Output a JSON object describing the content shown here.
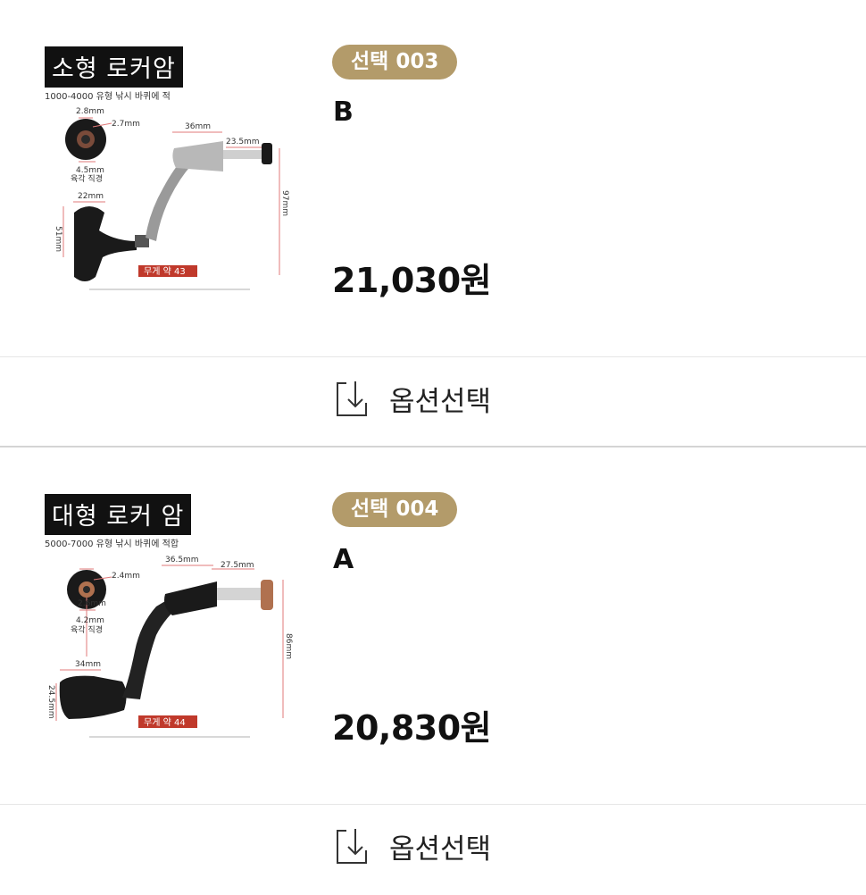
{
  "products": [
    {
      "image": {
        "title": "소형 로커암",
        "subtitle": "1000-4000 유형 낚시 바퀴에 적",
        "dims": {
          "top_a": "2.8mm",
          "top_b": "2.7mm",
          "bottom": "4.5mm",
          "hex_label": "육각 직경",
          "handle_width": "22mm",
          "handle_height": "51mm",
          "arm_length": "36mm",
          "shaft": "23.5mm",
          "height": "97mm"
        },
        "weight": "무게 약 43"
      },
      "badge": "선택 003",
      "option": "B",
      "price": "21,030원",
      "select_label": "옵션선택"
    },
    {
      "image": {
        "title": "대형 로커 암",
        "subtitle": "5000-7000 유형 낚시 바퀴에 적합",
        "dims": {
          "top_a": "2.6mm",
          "top_b": "2.4mm",
          "bottom": "4.2mm",
          "hex_label": "육각 직경",
          "handle_width": "34mm",
          "handle_height": "24.5mm",
          "arm_length": "36.5mm",
          "shaft": "27.5mm",
          "height": "86mm"
        },
        "weight": "무게 약 44"
      },
      "badge": "선택 004",
      "option": "A",
      "price": "20,830원",
      "select_label": "옵션선택"
    }
  ],
  "colors": {
    "badge_bg": "#b39b6a",
    "dimension_line": "#e07a7a",
    "weight_tag": "#c0392b"
  },
  "icons": {
    "select": "download-box-icon"
  }
}
